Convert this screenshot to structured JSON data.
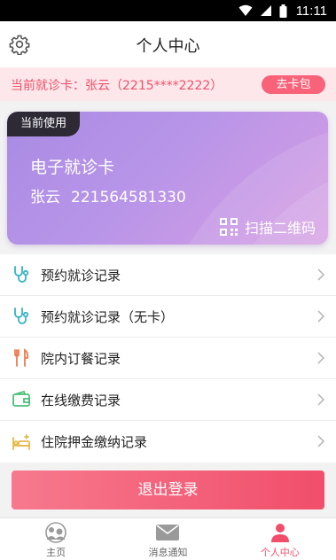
{
  "status_bar": {
    "time": "11:11"
  },
  "header": {
    "title": "个人中心",
    "settings_icon": "gear-icon"
  },
  "current_card": {
    "text": "当前就诊卡：张云（2215****2222）",
    "wallet_button": "去卡包"
  },
  "card": {
    "badge": "当前使用",
    "title": "电子就诊卡",
    "holder_name": "张云",
    "card_number": "221564581330",
    "scan_label": "扫描二维码",
    "gradient_start": "#a98be4",
    "gradient_end": "#d69ee3"
  },
  "menu": [
    {
      "label": "预约就诊记录",
      "icon": "stethoscope-icon"
    },
    {
      "label": "预约就诊记录（无卡）",
      "icon": "stethoscope-icon"
    },
    {
      "label": "院内订餐记录",
      "icon": "fork-knife-icon"
    },
    {
      "label": "在线缴费记录",
      "icon": "wallet-icon"
    },
    {
      "label": "住院押金缴纳记录",
      "icon": "hospital-bed-icon"
    }
  ],
  "logout_button": "退出登录",
  "tabs": [
    {
      "label": "主页",
      "icon": "home-icon",
      "active": false
    },
    {
      "label": "消息通知",
      "icon": "mail-icon",
      "active": false
    },
    {
      "label": "个人中心",
      "icon": "person-icon",
      "active": true
    }
  ],
  "colors": {
    "accent": "#f14e6b",
    "banner_bg": "#fde7ea",
    "icon_teal": "#35b3c4"
  }
}
